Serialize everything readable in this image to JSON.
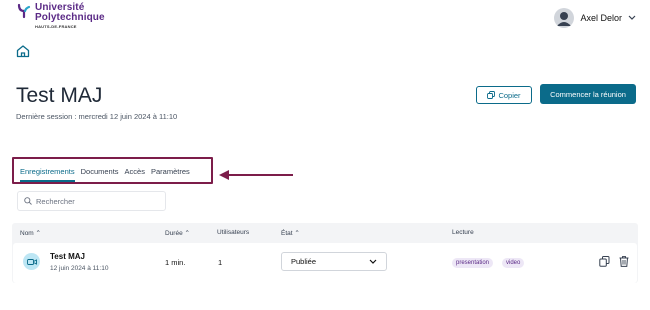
{
  "header": {
    "logo": {
      "line1": "Université",
      "line2": "Polytechnique",
      "line3": "HAUTS-DE-FRANCE",
      "icon": "upf-logo-icon"
    },
    "user": {
      "name": "Axel Delor",
      "avatar_icon": "user-avatar-icon",
      "chevron_icon": "chevron-down-icon"
    },
    "home_icon": "home-icon"
  },
  "room": {
    "title": "Test MAJ",
    "last_session": "Dernière session : mercredi 12 juin 2024 à 11:10",
    "copy_label": "Copier",
    "start_label": "Commencer la réunion"
  },
  "tabs": [
    {
      "label": "Enregistrements",
      "active": true
    },
    {
      "label": "Documents",
      "active": false
    },
    {
      "label": "Accès",
      "active": false
    },
    {
      "label": "Paramètres",
      "active": false
    }
  ],
  "search": {
    "placeholder": "Rechercher"
  },
  "table": {
    "headers": {
      "name": "Nom ⌃",
      "duration": "Durée ⌃",
      "users": "Utilisateurs",
      "state": "État ⌃",
      "playback": "Lecture"
    },
    "rows": [
      {
        "name": "Test MAJ",
        "date": "12 juin 2024 à 11:10",
        "duration": "1 min.",
        "users": "1",
        "state": "Publiée",
        "formats": [
          "presentation",
          "video"
        ]
      }
    ]
  },
  "colors": {
    "brand_purple": "#5b2a86",
    "accent_teal": "#0b6b8a",
    "highlight_box": "#7c1d4a"
  }
}
